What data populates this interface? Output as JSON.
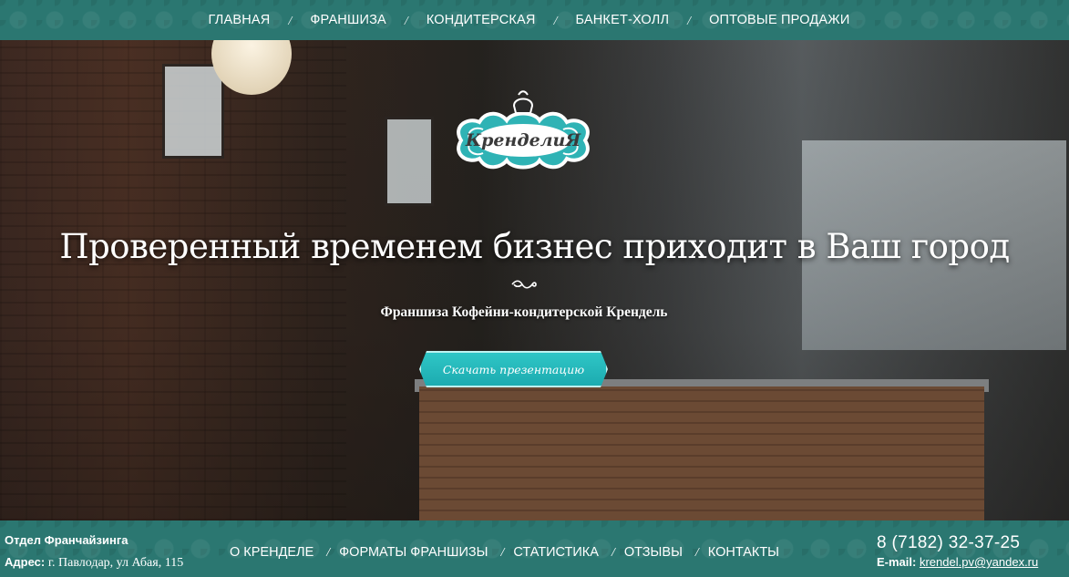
{
  "top_nav": {
    "items": [
      "ГЛАВНАЯ",
      "ФРАНШИЗА",
      "КОНДИТЕРСКАЯ",
      "БАНКЕТ-ХОЛЛ",
      "ОПТОВЫЕ ПРОДАЖИ"
    ],
    "separator": "/"
  },
  "hero": {
    "logo_text": "КренделиЯ",
    "headline": "Проверенный временем бизнес приходит в Ваш город",
    "subtitle": "Франшиза Кофейни-кондитерской Крендель",
    "cta_label": "Скачать презентацию"
  },
  "footer": {
    "department": "Отдел Франчайзинга",
    "address_label": "Адрес:",
    "address_value": "г. Павлодар, ул Абая, 115",
    "nav": [
      "О КРЕНДЕЛЕ",
      "ФОРМАТЫ ФРАНШИЗЫ",
      "СТАТИСТИКА",
      "ОТЗЫВЫ",
      "КОНТАКТЫ"
    ],
    "separator": "/",
    "phone": "8 (7182) 32-37-25",
    "email_label": "E-mail:",
    "email": "krendel.pv@yandex.ru"
  },
  "colors": {
    "teal_bar": "#2b7771",
    "cta": "#1fb4b6",
    "logo_teal": "#2fb3b5"
  }
}
